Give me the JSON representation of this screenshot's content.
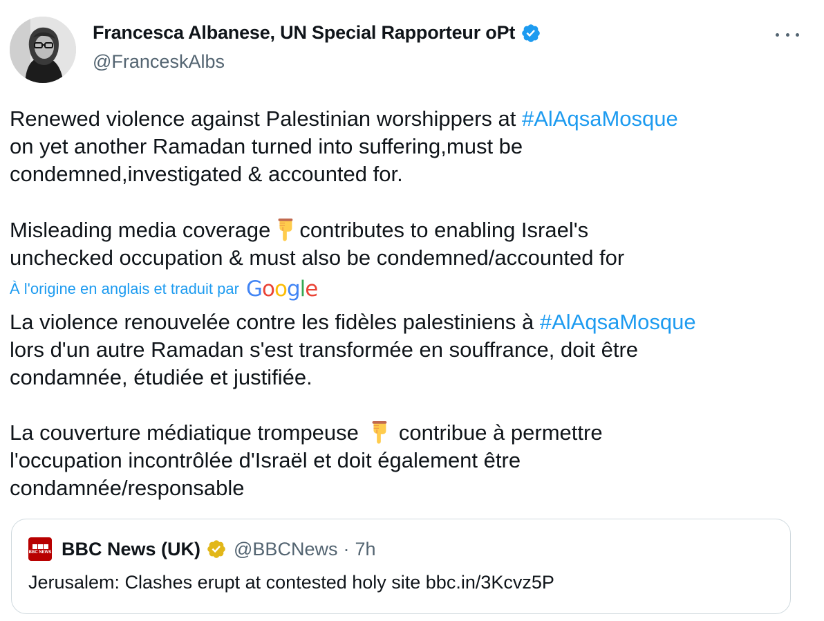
{
  "author": {
    "name": "Francesca Albanese, UN Special Rapporteur oPt",
    "handle": "@FranceskAlbs"
  },
  "tweet": {
    "en_p1_a": "Renewed violence against Palestinian worshippers at ",
    "en_p1_hashtag": "#AlAqsaMosque",
    "en_p1_b": "\non yet another Ramadan turned into suffering,must be\ncondemned,investigated & accounted for.",
    "en_p2_a": "Misleading media coverage",
    "en_p2_b": "contributes to enabling Israel's\nunchecked occupation & must also be condemned/accounted for",
    "translation_label": "À l'origine en anglais et traduit par",
    "fr_p1_a": "La violence renouvelée contre les fidèles palestiniens à ",
    "fr_p1_hashtag": "#AlAqsaMosque",
    "fr_p1_b": "\nlors d'un autre Ramadan s'est transformée en souffrance, doit être\ncondamnée, étudiée et justifiée.",
    "fr_p2_a": "La couverture médiatique trompeuse",
    "fr_p2_b": "contribue à permettre\nl'occupation incontrôlée d'Israël et doit également être\ncondamnée/responsable"
  },
  "quote": {
    "name": "BBC News (UK)",
    "handle": "@BBCNews",
    "separator": "·",
    "time": "7h",
    "text": "Jerusalem: Clashes erupt at contested holy site bbc.in/3Kcvz5P",
    "logo_text": "BBC NEWS"
  },
  "google_logo": [
    "G",
    "o",
    "o",
    "g",
    "l",
    "e"
  ],
  "colors": {
    "link": "#1d9bf0",
    "text": "#0f1419",
    "muted": "#536471",
    "verified_blue": "#1d9bf0",
    "verified_gold": "#e2b719",
    "bbc_red": "#b80000"
  },
  "icons": [
    "verified-badge-icon",
    "more-options-icon",
    "backhand-pointing-down-emoji",
    "google-logo",
    "bbc-news-logo",
    "gold-verified-badge-icon"
  ]
}
